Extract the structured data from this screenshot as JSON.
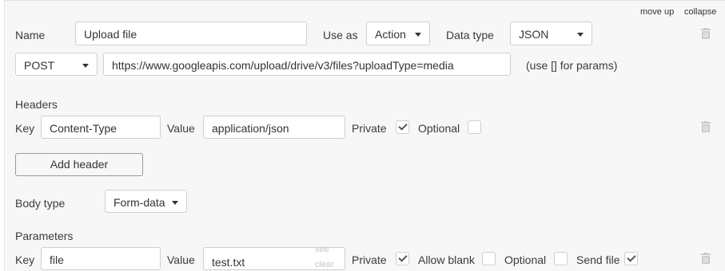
{
  "top_links": {
    "move_up": "move up",
    "collapse": "collapse"
  },
  "call": {
    "name_label": "Name",
    "name_value": "Upload file",
    "use_as_label": "Use as",
    "use_as_value": "Action",
    "data_type_label": "Data type",
    "data_type_value": "JSON",
    "method_value": "POST",
    "url_value": "https://www.googleapis.com/upload/drive/v3/files?uploadType=media",
    "url_hint": "(use [] for params)"
  },
  "headers": {
    "section_label": "Headers",
    "key_label": "Key",
    "key_value": "Content-Type",
    "value_label": "Value",
    "value_value": "application/json",
    "private_label": "Private",
    "private_checked": true,
    "optional_label": "Optional",
    "optional_checked": false,
    "add_header_label": "Add header"
  },
  "body": {
    "body_type_label": "Body type",
    "body_type_value": "Form-data"
  },
  "parameters": {
    "section_label": "Parameters",
    "key_label": "Key",
    "key_value": "file",
    "value_label": "Value",
    "value_value": "test.txt",
    "see_label": "see",
    "clear_label": "clear",
    "private_label": "Private",
    "private_checked": true,
    "allow_blank_label": "Allow blank",
    "allow_blank_checked": false,
    "optional_label": "Optional",
    "optional_checked": false,
    "send_file_label": "Send file",
    "send_file_checked": true
  },
  "icons": {
    "delete": "trash-icon",
    "dropdown": "caret-down-icon",
    "check": "checkmark-icon"
  },
  "colors": {
    "panel_bg": "#f7f7f7",
    "border": "#cfcfcf",
    "trash": "#c9c9c9"
  }
}
